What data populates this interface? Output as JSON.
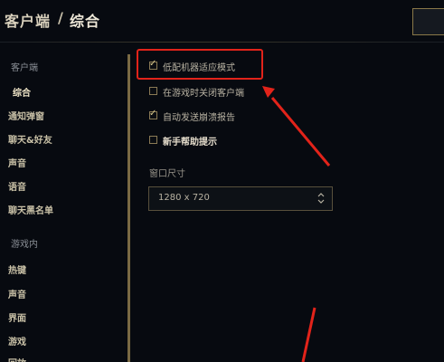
{
  "header": {
    "breadcrumb_root": "客户端",
    "separator": "/",
    "breadcrumb_current": "综合"
  },
  "sidebar": {
    "client_section": "客户端",
    "client_items": [
      "综合",
      "通知弹窗",
      "聊天&好友",
      "声音",
      "语音",
      "聊天黑名单"
    ],
    "ingame_section": "游戏内",
    "ingame_items": [
      "热键",
      "声音",
      "界面",
      "游戏",
      "回放"
    ]
  },
  "options": [
    {
      "label": "低配机器适应模式",
      "checked": true
    },
    {
      "label": "在游戏时关闭客户端",
      "checked": false
    },
    {
      "label": "自动发送崩溃报告",
      "checked": true
    },
    {
      "label": "新手帮助提示",
      "checked": false
    }
  ],
  "window_size": {
    "label": "窗口尺寸",
    "value": "1280 x 720"
  },
  "colors": {
    "accent_gold": "#c8aa6e",
    "annotation_red": "#e2231a",
    "background": "#070a10"
  }
}
